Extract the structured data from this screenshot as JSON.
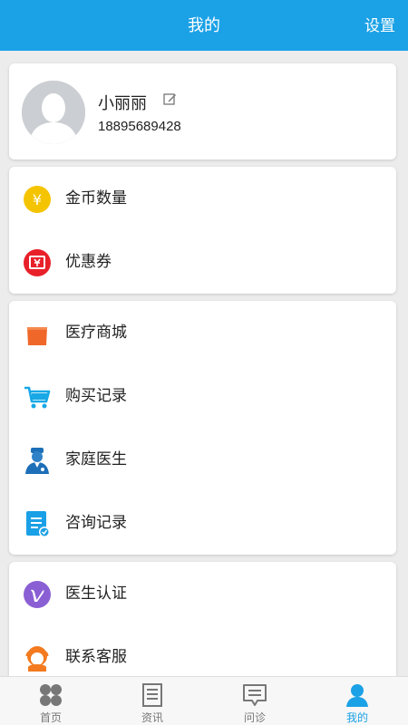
{
  "header": {
    "title": "我的",
    "settings_label": "设置",
    "bg_color": "#1ba1e6"
  },
  "profile": {
    "name": "小丽丽",
    "phone": "18895689428"
  },
  "section1": {
    "items": [
      {
        "label": "金币数量",
        "icon": "gold-coin-icon"
      },
      {
        "label": "优惠券",
        "icon": "coupon-icon"
      }
    ]
  },
  "section2": {
    "items": [
      {
        "label": "医疗商城",
        "icon": "shopping-bag-icon"
      },
      {
        "label": "购买记录",
        "icon": "cart-icon"
      },
      {
        "label": "家庭医生",
        "icon": "doctor-icon"
      },
      {
        "label": "咨询记录",
        "icon": "document-check-icon"
      }
    ]
  },
  "section3": {
    "items": [
      {
        "label": "医生认证",
        "icon": "verified-v-icon"
      },
      {
        "label": "联系客服",
        "icon": "customer-service-icon"
      }
    ]
  },
  "tabs": [
    {
      "label": "首页",
      "icon": "home-grid-icon",
      "active": false
    },
    {
      "label": "资讯",
      "icon": "news-icon",
      "active": false
    },
    {
      "label": "问诊",
      "icon": "consult-icon",
      "active": false
    },
    {
      "label": "我的",
      "icon": "user-icon",
      "active": true
    }
  ],
  "coin_symbol": "¥"
}
